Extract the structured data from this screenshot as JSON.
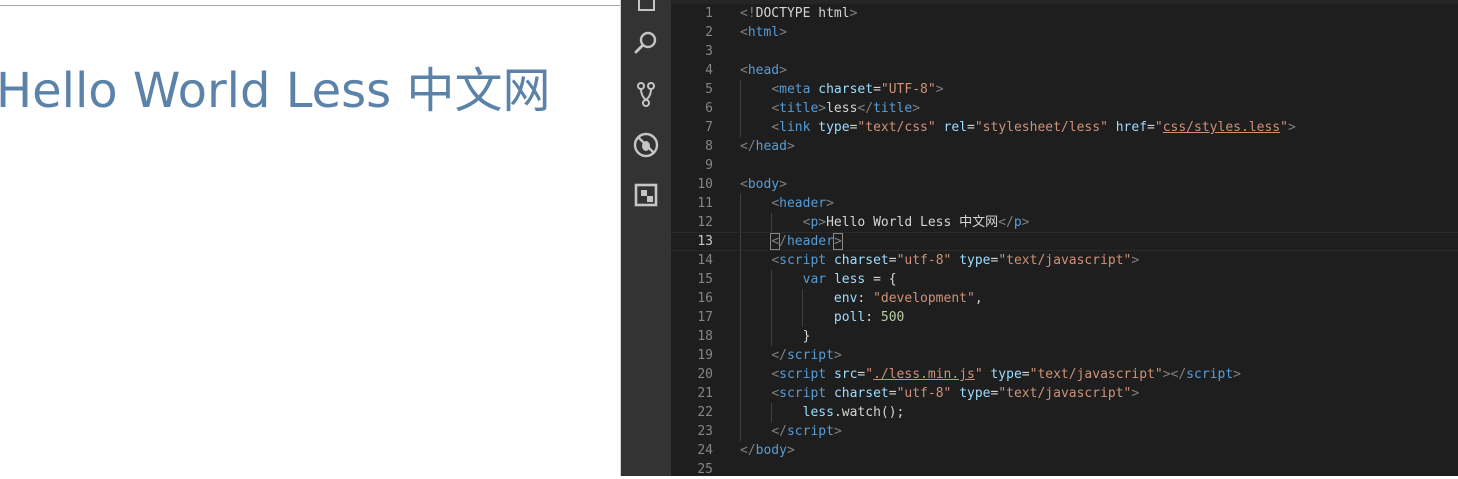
{
  "preview": {
    "heading": "Hello World Less 中文网"
  },
  "activity_bar": {
    "icons": [
      "explorer-icon",
      "search-icon",
      "source-control-icon",
      "debug-icon",
      "extensions-icon"
    ]
  },
  "editor": {
    "current_line": 13,
    "lines": [
      {
        "n": "1",
        "tokens": [
          [
            "punct",
            "<!"
          ],
          [
            "text",
            "DOCTYPE html"
          ],
          [
            "punct",
            ">"
          ]
        ]
      },
      {
        "n": "2",
        "tokens": [
          [
            "punct",
            "<"
          ],
          [
            "tag",
            "html"
          ],
          [
            "punct",
            ">"
          ]
        ]
      },
      {
        "n": "3",
        "tokens": []
      },
      {
        "n": "4",
        "tokens": [
          [
            "punct",
            "<"
          ],
          [
            "tag",
            "head"
          ],
          [
            "punct",
            ">"
          ]
        ]
      },
      {
        "n": "5",
        "tokens": [
          [
            "text",
            "    "
          ],
          [
            "punct",
            "<"
          ],
          [
            "tag",
            "meta"
          ],
          [
            "text",
            " "
          ],
          [
            "attr",
            "charset"
          ],
          [
            "text",
            "="
          ],
          [
            "str",
            "\"UTF-8\""
          ],
          [
            "punct",
            ">"
          ]
        ]
      },
      {
        "n": "6",
        "tokens": [
          [
            "text",
            "    "
          ],
          [
            "punct",
            "<"
          ],
          [
            "tag",
            "title"
          ],
          [
            "punct",
            ">"
          ],
          [
            "text",
            "less"
          ],
          [
            "punct",
            "</"
          ],
          [
            "tag",
            "title"
          ],
          [
            "punct",
            ">"
          ]
        ]
      },
      {
        "n": "7",
        "tokens": [
          [
            "text",
            "    "
          ],
          [
            "punct",
            "<"
          ],
          [
            "tag",
            "link"
          ],
          [
            "text",
            " "
          ],
          [
            "attr",
            "type"
          ],
          [
            "text",
            "="
          ],
          [
            "str",
            "\"text/css\""
          ],
          [
            "text",
            " "
          ],
          [
            "attr",
            "rel"
          ],
          [
            "text",
            "="
          ],
          [
            "str",
            "\"stylesheet/less\""
          ],
          [
            "text",
            " "
          ],
          [
            "attr",
            "href"
          ],
          [
            "text",
            "="
          ],
          [
            "str",
            "\""
          ],
          [
            "strlink",
            "css/styles.less"
          ],
          [
            "str",
            "\""
          ],
          [
            "punct",
            ">"
          ]
        ]
      },
      {
        "n": "8",
        "tokens": [
          [
            "punct",
            "</"
          ],
          [
            "tag",
            "head"
          ],
          [
            "punct",
            ">"
          ]
        ]
      },
      {
        "n": "9",
        "tokens": []
      },
      {
        "n": "10",
        "tokens": [
          [
            "punct",
            "<"
          ],
          [
            "tag",
            "body"
          ],
          [
            "punct",
            ">"
          ]
        ]
      },
      {
        "n": "11",
        "tokens": [
          [
            "text",
            "    "
          ],
          [
            "punct",
            "<"
          ],
          [
            "tag",
            "header"
          ],
          [
            "punct",
            ">"
          ]
        ]
      },
      {
        "n": "12",
        "tokens": [
          [
            "text",
            "        "
          ],
          [
            "punct",
            "<"
          ],
          [
            "tag",
            "p"
          ],
          [
            "punct",
            ">"
          ],
          [
            "text",
            "Hello World Less 中文网"
          ],
          [
            "punct",
            "</"
          ],
          [
            "tag",
            "p"
          ],
          [
            "punct",
            ">"
          ]
        ]
      },
      {
        "n": "13",
        "tokens": [
          [
            "text",
            "    "
          ],
          [
            "punctbox",
            "<"
          ],
          [
            "punct",
            "/"
          ],
          [
            "tag",
            "header"
          ],
          [
            "punctbox",
            ">"
          ]
        ]
      },
      {
        "n": "14",
        "tokens": [
          [
            "text",
            "    "
          ],
          [
            "punct",
            "<"
          ],
          [
            "tag",
            "script"
          ],
          [
            "text",
            " "
          ],
          [
            "attr",
            "charset"
          ],
          [
            "text",
            "="
          ],
          [
            "str",
            "\"utf-8\""
          ],
          [
            "text",
            " "
          ],
          [
            "attr",
            "type"
          ],
          [
            "text",
            "="
          ],
          [
            "str",
            "\"text/javascript\""
          ],
          [
            "punct",
            ">"
          ]
        ]
      },
      {
        "n": "15",
        "tokens": [
          [
            "text",
            "        "
          ],
          [
            "kw",
            "var"
          ],
          [
            "text",
            " "
          ],
          [
            "attr",
            "less"
          ],
          [
            "text",
            " = {"
          ]
        ]
      },
      {
        "n": "16",
        "tokens": [
          [
            "text",
            "            "
          ],
          [
            "attr",
            "env"
          ],
          [
            "text",
            ": "
          ],
          [
            "str",
            "\"development\""
          ],
          [
            "text",
            ","
          ]
        ]
      },
      {
        "n": "17",
        "tokens": [
          [
            "text",
            "            "
          ],
          [
            "attr",
            "poll"
          ],
          [
            "text",
            ": "
          ],
          [
            "num",
            "500"
          ]
        ]
      },
      {
        "n": "18",
        "tokens": [
          [
            "text",
            "        }"
          ]
        ]
      },
      {
        "n": "19",
        "tokens": [
          [
            "text",
            "    "
          ],
          [
            "punct",
            "</"
          ],
          [
            "tag",
            "script"
          ],
          [
            "punct",
            ">"
          ]
        ]
      },
      {
        "n": "20",
        "tokens": [
          [
            "text",
            "    "
          ],
          [
            "punct",
            "<"
          ],
          [
            "tag",
            "script"
          ],
          [
            "text",
            " "
          ],
          [
            "attr",
            "src"
          ],
          [
            "text",
            "="
          ],
          [
            "str",
            "\""
          ],
          [
            "strlink",
            "./less.min.js"
          ],
          [
            "str",
            "\""
          ],
          [
            "text",
            " "
          ],
          [
            "attr",
            "type"
          ],
          [
            "text",
            "="
          ],
          [
            "str",
            "\"text/javascript\""
          ],
          [
            "punct",
            "></"
          ],
          [
            "tag",
            "script"
          ],
          [
            "punct",
            ">"
          ]
        ]
      },
      {
        "n": "21",
        "tokens": [
          [
            "text",
            "    "
          ],
          [
            "punct",
            "<"
          ],
          [
            "tag",
            "script"
          ],
          [
            "text",
            " "
          ],
          [
            "attr",
            "charset"
          ],
          [
            "text",
            "="
          ],
          [
            "str",
            "\"utf-8\""
          ],
          [
            "text",
            " "
          ],
          [
            "attr",
            "type"
          ],
          [
            "text",
            "="
          ],
          [
            "str",
            "\"text/javascript\""
          ],
          [
            "punct",
            ">"
          ]
        ]
      },
      {
        "n": "22",
        "tokens": [
          [
            "text",
            "        "
          ],
          [
            "attr",
            "less"
          ],
          [
            "text",
            "."
          ],
          [
            "text",
            "watch"
          ],
          [
            "text",
            "();"
          ]
        ]
      },
      {
        "n": "23",
        "tokens": [
          [
            "text",
            "    "
          ],
          [
            "punct",
            "</"
          ],
          [
            "tag",
            "script"
          ],
          [
            "punct",
            ">"
          ]
        ]
      },
      {
        "n": "24",
        "tokens": [
          [
            "punct",
            "</"
          ],
          [
            "tag",
            "body"
          ],
          [
            "punct",
            ">"
          ]
        ]
      },
      {
        "n": "25",
        "tokens": []
      }
    ]
  },
  "colors": {
    "heading": "#5b82a8",
    "editor_bg": "#1e1e1e",
    "activity_bg": "#333333",
    "tag": "#569cd6",
    "attr": "#9cdcfe",
    "string": "#ce9178",
    "number": "#b5cea8"
  }
}
